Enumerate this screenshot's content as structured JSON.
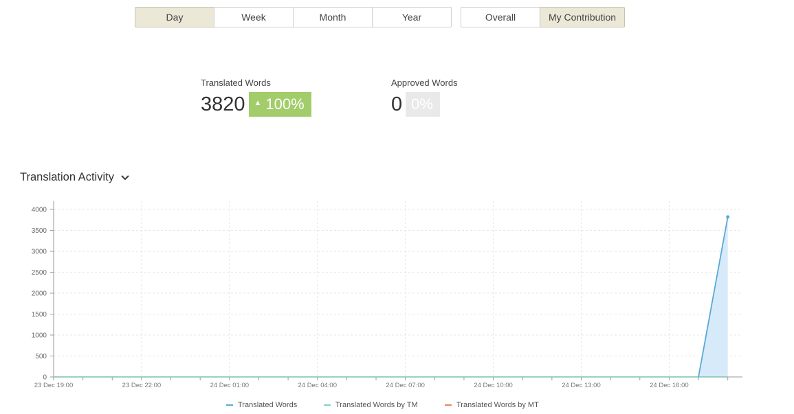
{
  "period_tabs": [
    {
      "label": "Day",
      "active": true
    },
    {
      "label": "Week",
      "active": false
    },
    {
      "label": "Month",
      "active": false
    },
    {
      "label": "Year",
      "active": false
    }
  ],
  "scope_tabs": [
    {
      "label": "Overall",
      "active": false
    },
    {
      "label": "My Contribution",
      "active": true
    }
  ],
  "stats": {
    "translated": {
      "label": "Translated Words",
      "value": "3820",
      "change": "100%",
      "trend_icon": "triangle-up-icon"
    },
    "approved": {
      "label": "Approved Words",
      "value": "0",
      "change": "0%"
    }
  },
  "section": {
    "title": "Translation Activity",
    "icon": "chevron-down-icon"
  },
  "colors": {
    "translated": "#5aa9d6",
    "tm": "#7fd3c9",
    "mt": "#e08a5c",
    "area": "#d7eaf9",
    "badge_up": "#a2cd6a",
    "badge_zero": "#e9e9e9"
  },
  "chart_data": {
    "type": "line",
    "x_labels": [
      "23 Dec 19:00",
      "23 Dec 22:00",
      "24 Dec 01:00",
      "24 Dec 04:00",
      "24 Dec 07:00",
      "24 Dec 10:00",
      "24 Dec 13:00",
      "24 Dec 16:00"
    ],
    "x_hours": [
      19,
      20,
      21,
      22,
      23,
      24,
      25,
      26,
      27,
      28,
      29,
      30,
      31,
      32,
      33,
      34,
      35,
      36,
      37,
      38,
      39,
      40,
      41,
      42
    ],
    "y_ticks": [
      0,
      500,
      1000,
      1500,
      2000,
      2500,
      3000,
      3500,
      4000
    ],
    "ylim": [
      0,
      4000
    ],
    "grid": true,
    "legend_position": "bottom",
    "series": [
      {
        "name": "Translated Words",
        "values": [
          0,
          0,
          0,
          0,
          0,
          0,
          0,
          0,
          0,
          0,
          0,
          0,
          0,
          0,
          0,
          0,
          0,
          0,
          0,
          0,
          0,
          0,
          0,
          0
        ],
        "last_value": 3820
      },
      {
        "name": "Translated Words by TM",
        "values": [
          0,
          0,
          0,
          0,
          0,
          0,
          0,
          0,
          0,
          0,
          0,
          0,
          0,
          0,
          0,
          0,
          0,
          0,
          0,
          0,
          0,
          0,
          0,
          0
        ]
      },
      {
        "name": "Translated Words by MT",
        "values": [
          0,
          0,
          0,
          0,
          0,
          0,
          0,
          0,
          0,
          0,
          0,
          0,
          0,
          0,
          0,
          0,
          0,
          0,
          0,
          0,
          0,
          0,
          0,
          0
        ]
      }
    ]
  }
}
